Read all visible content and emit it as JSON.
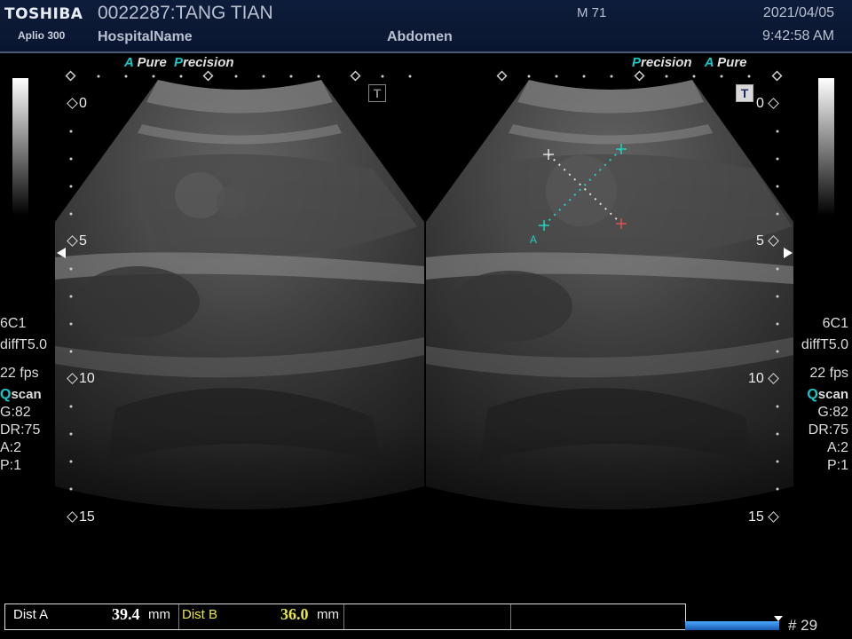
{
  "header": {
    "brand": "TOSHIBA",
    "model": "Aplio 300",
    "patient": "0022287:TANG TIAN",
    "hospital": "HospitalName",
    "exam": "Abdomen",
    "mi": "M 71",
    "date": "2021/04/05",
    "time": "9:42:58 AM"
  },
  "left_image": {
    "label_a": "A",
    "label_pure": "Pure",
    "label_p": "P",
    "label_precision": "recision",
    "t_badge": "T"
  },
  "right_image": {
    "label_p": "P",
    "label_precision": "recision",
    "label_a": "A",
    "label_pure": "Pure",
    "t_badge": "T",
    "caliper_label": "A"
  },
  "depth_scale": [
    "0",
    "5",
    "10",
    "15"
  ],
  "params": {
    "transducer": "6C1",
    "preset": "diffT5.0",
    "fps": "22 fps",
    "qscan_q": "Q",
    "qscan_rest": "scan",
    "gain": "G:82",
    "dr": "DR:75",
    "a": "A:2",
    "p": "P:1"
  },
  "measurements": [
    {
      "label": "Dist A",
      "value": "39.4",
      "unit": "mm",
      "label_color": "#ffffff",
      "value_color": "#ffffff"
    },
    {
      "label": "Dist B",
      "value": "36.0",
      "unit": "mm",
      "label_color": "#e8e840",
      "value_color": "#e8e840"
    }
  ],
  "frame_counter": "# 29",
  "colors": {
    "accent_cyan": "#18c8c8",
    "header_bg": "#0d1c3a",
    "caliper_a": "#20d0c0",
    "caliper_b": "#e0e0e0"
  }
}
